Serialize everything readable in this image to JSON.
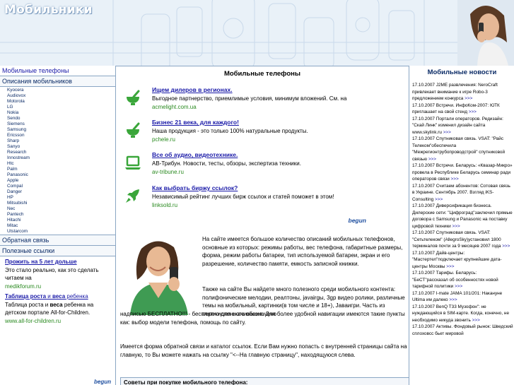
{
  "header": {
    "site_title": "Мобильники"
  },
  "left_nav": {
    "item_phones": "Мобильные телефоны",
    "item_descriptions": "Описания мобильников",
    "brands": [
      "Kyocera",
      "Audiovox",
      "Motorola",
      "LG",
      "Nokia",
      "Sendo",
      "Siemens",
      "Samsung",
      "Ericsson",
      "Sharp",
      "Sanyo",
      "Research",
      "Innostream",
      "Htc",
      "Palm",
      "Panasonic",
      "Apple",
      "Compal",
      "Danger",
      "HP",
      "Mitsubishi",
      "Nec",
      "Pantech",
      "Hitachi",
      "Mitac",
      "Utstarcom"
    ],
    "item_feedback": "Обратная связь",
    "item_links": "Полезные ссылки"
  },
  "left_ads": [
    {
      "title": "Прожить на 5 лет дольше",
      "text": "Это стало реально, как это сделать читаем на",
      "url": "medikforum.ru"
    },
    {
      "title_parts": [
        "Таблица роста",
        " и ",
        "веса",
        " ребенка"
      ],
      "text_parts": [
        "Таблица роста и ",
        "веса",
        " ребенка на детском портале All-for-Children."
      ],
      "url": "www.all-for-children.ru"
    }
  ],
  "left_brand": "begun",
  "center": {
    "title": "Мобильные телефоны",
    "ads": [
      {
        "icon": "mortar-bowl-icon",
        "head": "Ищем дилеров в регионах.",
        "desc": "Выгодное партнерство, приемлимые условия, минимум вложений. См. на",
        "link": "acmelight.com.ua"
      },
      {
        "icon": "mortar-bowl-icon",
        "head": "Бизнес 21 века, для каждого!",
        "desc": "Наша продукция - это только 100% натуральные продукты.",
        "link": "pchele.ru"
      },
      {
        "icon": "laptop-icon",
        "head": "Все об аудио, видеотехнике.",
        "desc": "АВ-Трибун. Новости, тесты, обзоры, экспертиза техники.",
        "link": "av-tribune.ru"
      },
      {
        "icon": "rocket-icon",
        "head": "Как выбрать биржу ссылок?",
        "desc": "Независимый рейтинг лучших бирж ссылок и статей поможет в этом!",
        "link": "linksold.ru"
      }
    ],
    "brand": "begun",
    "paragraph1": "На сайте имеется большое количество описаний мобильных телефонов, основные из которых: режимы работы, вес телефона, габаритные размеры, форма, режим работы батареи, тип используемой батареи, экран и его разрешение, количество памяти, емкость записной книжки.",
    "paragraph2a": "Также на сайте Вы найдете много полезного среди мобильного контента: полифонические мелодии, реалтоны, javairgы, 3gp видео ролики, различные темы на мобильный, картинки(в том числе и 18+), Jaвaигри. Часть из перечисленного обозначено",
    "paragraph2b": "надписью БЕСПЛАТНО!!! - бесплатно для скачивания. Для более удобной навигации имеются такие пункты как: выбор модели телефона, помощь по сайту.",
    "paragraph3": "Имеется форма обратной связи и каталог ссылок. Если Вам нужно попасть с внутренней страницы сайта на главную, то Вы можете нажать на ссылку \"<--На главную страницу\", находящуюся слева.",
    "tips_title": "Советы при покупке мобильного телефона:"
  },
  "news": {
    "title": "Мобильные новости",
    "items": [
      {
        "text": "17.10.2007 J2ME развлечения: NeroCraft привлекает внимание к игре Robo-3 предложением конкурса",
        "more": ">>>"
      },
      {
        "text": "17.10.2007 Встречи. ИнфоКом-2007: ЮТК приглашает на свой стенд",
        "more": ">>>"
      },
      {
        "text": "17.10.2007 Портали операторов. Редизайн: \"Скай Линк\" изменил дизайн сайта www.skylink.ru",
        "more": ">>>"
      },
      {
        "text": "17.10.2007 Спутниковая связь. VSAT: \"Райс Телеком\"обеспечила \"Межрегионтрубопроводстрой\" спутниковой связью",
        "more": ">>>"
      },
      {
        "text": "17.10.2007 Встречи. Беларусь: «Квазар-Микро» провела в Республике Беларусь семинар ради операторов связи",
        "more": ">>>"
      },
      {
        "text": "17.10.2007 Считаем абонентов: Сотовая связь в Украине. Сентябрь 2007. Взгляд iKS-Consulting",
        "more": ">>>"
      },
      {
        "text": "17.10.2007 Диверсификация бизнеса. Дилерские сети: \"Цифроград\"заключил прямые договора с Samsung и Panasonic на поставку цифровой техники",
        "more": ">>>"
      },
      {
        "text": "17.10.2007 Спутниковая связь. VSAT: \"Сетьтелеком\" (AllegroSky)установил 1800 терминалов почти за 9 месяцев 2007 года",
        "more": ">>>"
      },
      {
        "text": "17.10.2007 Дайв-центры: \"Мастертел\"подключает крупнейшие дата-центры Москвы",
        "more": ">>>"
      },
      {
        "text": "17.10.2007 Тарифы. Беларусь: \"БеСТ\"рассказал об особенностях новой тарифной политики",
        "more": ">>>"
      },
      {
        "text": "17.10.2007 I-mate JAMA 101/201: Накануне Ultima им далеко",
        "more": ">>>"
      },
      {
        "text": "17.10.2007 BenQ T33 Myзофон\": не нуждающийся в SIM-карте. Когда, конечно, не необходимо никуда звонить",
        "more": ">>>"
      },
      {
        "text": "17.10.2007 Активы. Фондовый рынок: Шведский сплоховсс бьет мировой",
        "more": ""
      }
    ]
  },
  "colors": {
    "link_blue": "#1a1aa8",
    "url_green": "#2a8a20",
    "border_blue": "#8aa6c4",
    "icon_green": "#3aa63a"
  }
}
